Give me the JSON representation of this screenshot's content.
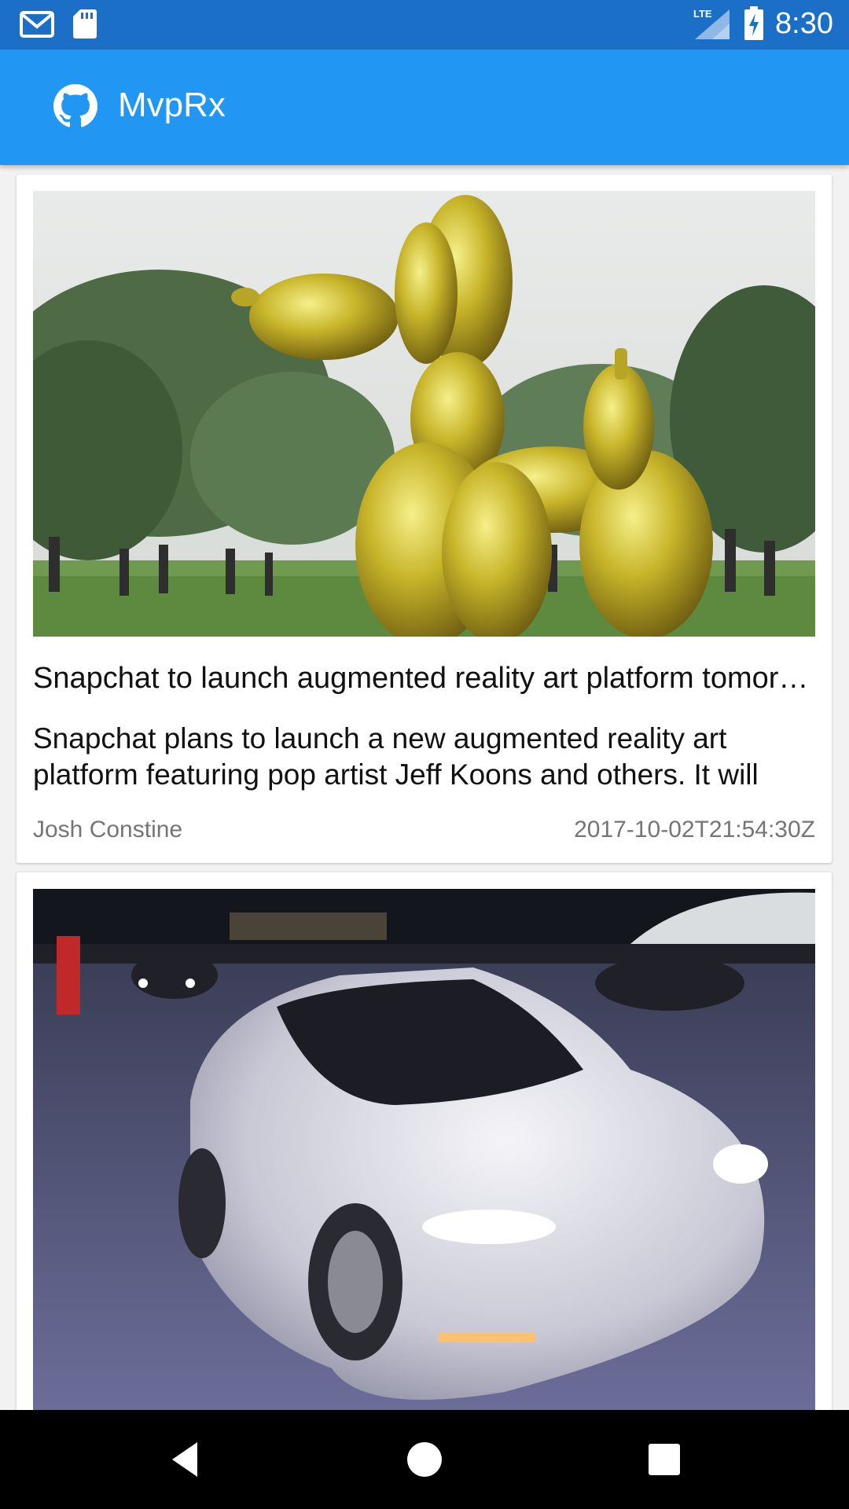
{
  "status_bar": {
    "time": "8:30",
    "network": "LTE",
    "icons": [
      "gmail-icon",
      "sd-card-icon",
      "lte-signal-icon",
      "battery-charging-icon"
    ],
    "background": "#1c6fc7"
  },
  "app_bar": {
    "title": "MvpRx",
    "logo_icon": "github-icon",
    "background": "#2196f3"
  },
  "articles": [
    {
      "image_subject": "giant gold balloon dog sculpture in a park",
      "title": "Snapchat to launch augmented reality art platform tomorrow",
      "description": "Snapchat plans to launch a new augmented reality art platform featuring pop artist Jeff Koons and others. It will",
      "author": "Josh Constine",
      "date": "2017-10-02T21:54:30Z"
    },
    {
      "image_subject": "white electric car at a night event",
      "title": "",
      "description": "",
      "author": "",
      "date": ""
    }
  ],
  "nav_bar": {
    "buttons": [
      "back-icon",
      "home-icon",
      "recents-icon"
    ]
  }
}
